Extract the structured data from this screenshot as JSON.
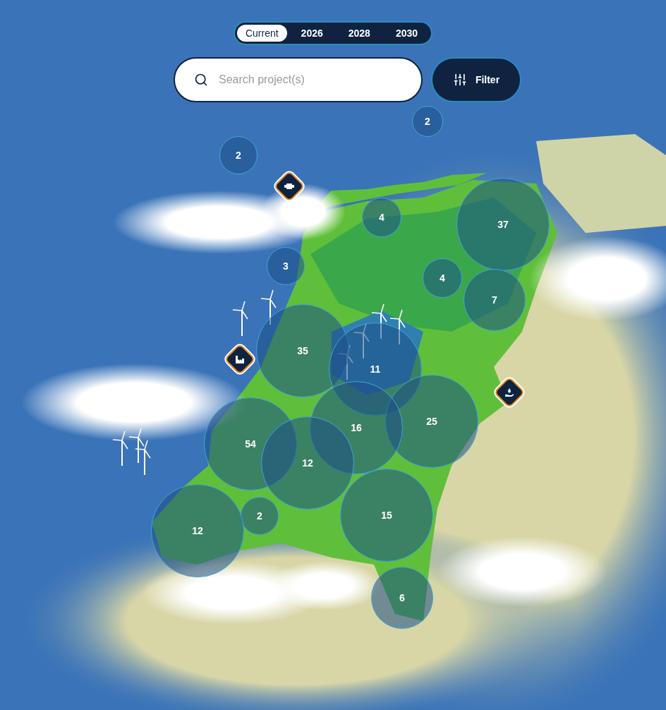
{
  "year_tabs": [
    {
      "label": "Current",
      "selected": true
    },
    {
      "label": "2026",
      "selected": false
    },
    {
      "label": "2028",
      "selected": false
    },
    {
      "label": "2030",
      "selected": false
    }
  ],
  "search": {
    "placeholder": "Search project(s)"
  },
  "filter_button": {
    "label": "Filter"
  },
  "map": {
    "clusters": [
      {
        "count": "2"
      },
      {
        "count": "2"
      },
      {
        "count": "4"
      },
      {
        "count": "37"
      },
      {
        "count": "3"
      },
      {
        "count": "4"
      },
      {
        "count": "7"
      },
      {
        "count": "35"
      },
      {
        "count": "11"
      },
      {
        "count": "25"
      },
      {
        "count": "16"
      },
      {
        "count": "54"
      },
      {
        "count": "12"
      },
      {
        "count": "2"
      },
      {
        "count": "12"
      },
      {
        "count": "15"
      },
      {
        "count": "6"
      }
    ],
    "markers": [
      {
        "kind": "device"
      },
      {
        "kind": "factory"
      },
      {
        "kind": "water"
      }
    ]
  }
}
